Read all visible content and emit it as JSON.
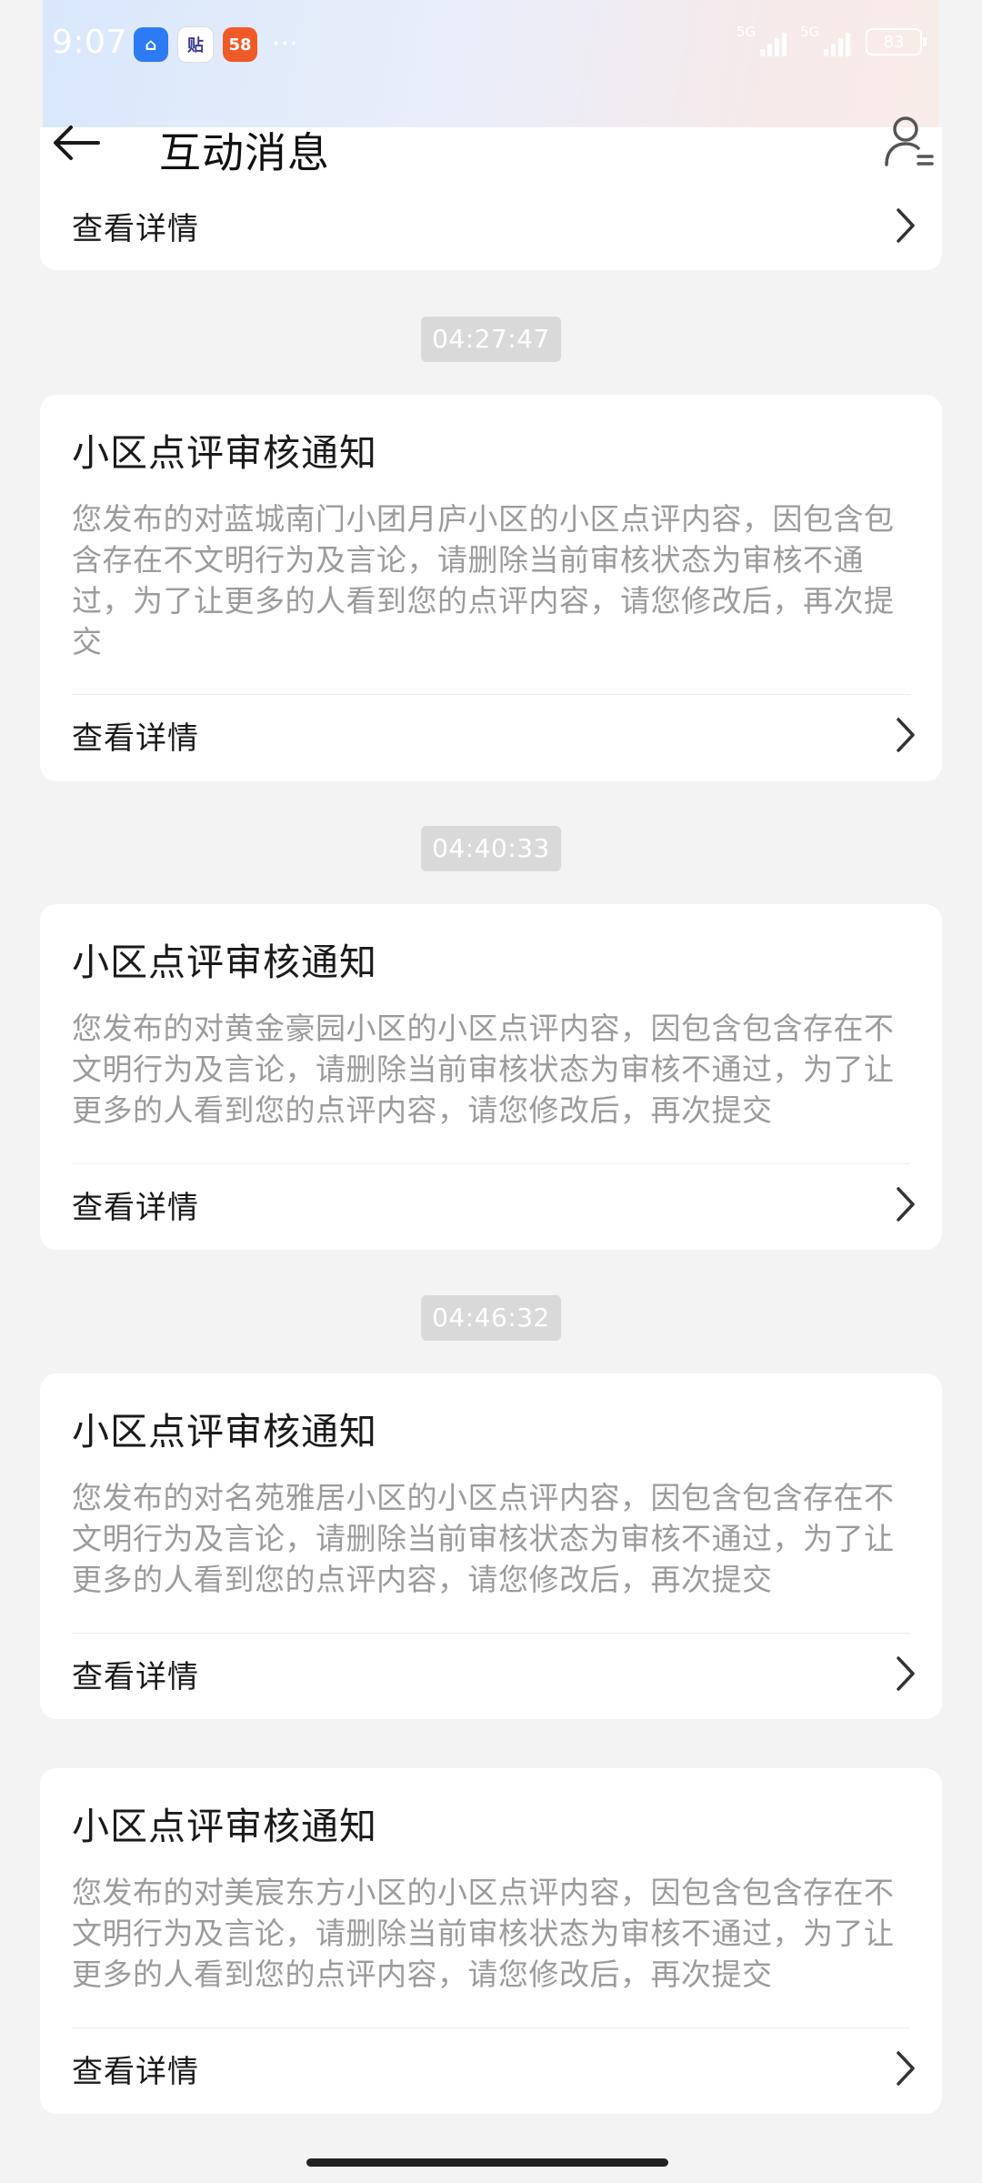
{
  "status_bar": {
    "time": "9:07",
    "app_icons": [
      {
        "name": "home-app-icon",
        "glyph": "⌂"
      },
      {
        "name": "tieba-app-icon",
        "glyph": "贴"
      },
      {
        "name": "58-app-icon",
        "glyph": "58"
      }
    ],
    "more": "···",
    "network_1": "5G",
    "network_2": "5G",
    "battery": "83"
  },
  "header": {
    "title": "互动消息"
  },
  "messages": [
    {
      "partial": true,
      "link_label": "查看详情"
    },
    {
      "timestamp": "04:27:47",
      "title": "小区点评审核通知",
      "body": "您发布的对蓝城南门小团月庐小区的小区点评内容，因包含包含存在不文明行为及言论，请删除当前审核状态为审核不通过，为了让更多的人看到您的点评内容，请您修改后，再次提交",
      "link_label": "查看详情"
    },
    {
      "timestamp": "04:40:33",
      "title": "小区点评审核通知",
      "body": "您发布的对黄金豪园小区的小区点评内容，因包含包含存在不文明行为及言论，请删除当前审核状态为审核不通过，为了让更多的人看到您的点评内容，请您修改后，再次提交",
      "link_label": "查看详情"
    },
    {
      "timestamp": "04:46:32",
      "title": "小区点评审核通知",
      "body": "您发布的对名苑雅居小区的小区点评内容，因包含包含存在不文明行为及言论，请删除当前审核状态为审核不通过，为了让更多的人看到您的点评内容，请您修改后，再次提交",
      "link_label": "查看详情"
    },
    {
      "title": "小区点评审核通知",
      "body": "您发布的对美宸东方小区的小区点评内容，因包含包含存在不文明行为及言论，请删除当前审核状态为审核不通过，为了让更多的人看到您的点评内容，请您修改后，再次提交",
      "link_label": "查看详情"
    }
  ],
  "colors": {
    "page_background": "#f3f3f3",
    "card_background": "#ffffff",
    "body_text": "#9b9b9b",
    "timestamp_badge": "#d9d9d9"
  }
}
